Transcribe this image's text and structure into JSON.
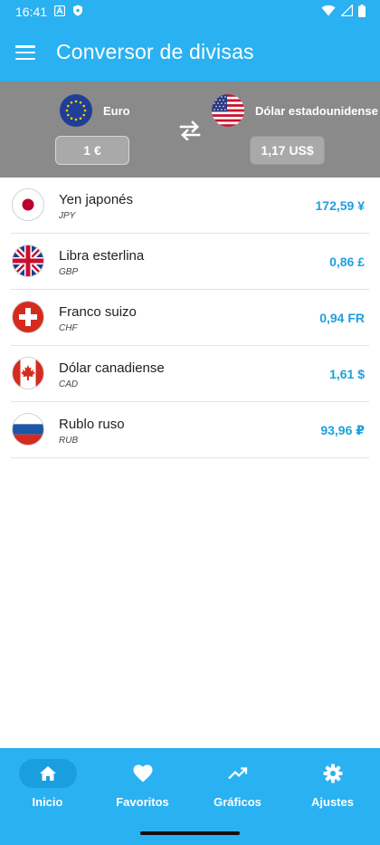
{
  "status": {
    "time": "16:41"
  },
  "app": {
    "title": "Conversor de divisas"
  },
  "converter": {
    "from": {
      "name": "Euro",
      "amount": "1 €",
      "flag": "eu-flag-icon"
    },
    "to": {
      "name": "Dólar estadounidense",
      "amount": "1,17 US$",
      "flag": "us-flag-icon"
    }
  },
  "rates": [
    {
      "name": "Yen japonés",
      "code": "JPY",
      "value": "172,59 ¥",
      "flag": "jp-flag-icon"
    },
    {
      "name": "Libra esterlina",
      "code": "GBP",
      "value": "0,86 £",
      "flag": "gb-flag-icon"
    },
    {
      "name": "Franco suizo",
      "code": "CHF",
      "value": "0,94 FR",
      "flag": "ch-flag-icon"
    },
    {
      "name": "Dólar canadiense",
      "code": "CAD",
      "value": "1,61 $",
      "flag": "ca-flag-icon"
    },
    {
      "name": "Rublo ruso",
      "code": "RUB",
      "value": "93,96 ₽",
      "flag": "ru-flag-icon"
    }
  ],
  "nav": {
    "items": [
      {
        "label": "Inicio",
        "icon": "home-icon",
        "active": true
      },
      {
        "label": "Favoritos",
        "icon": "heart-icon",
        "active": false
      },
      {
        "label": "Gráficos",
        "icon": "trending-up-icon",
        "active": false
      },
      {
        "label": "Ajustes",
        "icon": "gear-icon",
        "active": false
      }
    ]
  },
  "colors": {
    "primary": "#2ab1f1",
    "converter_bg": "#8a8a8a",
    "value_text": "#1ea0dc"
  }
}
